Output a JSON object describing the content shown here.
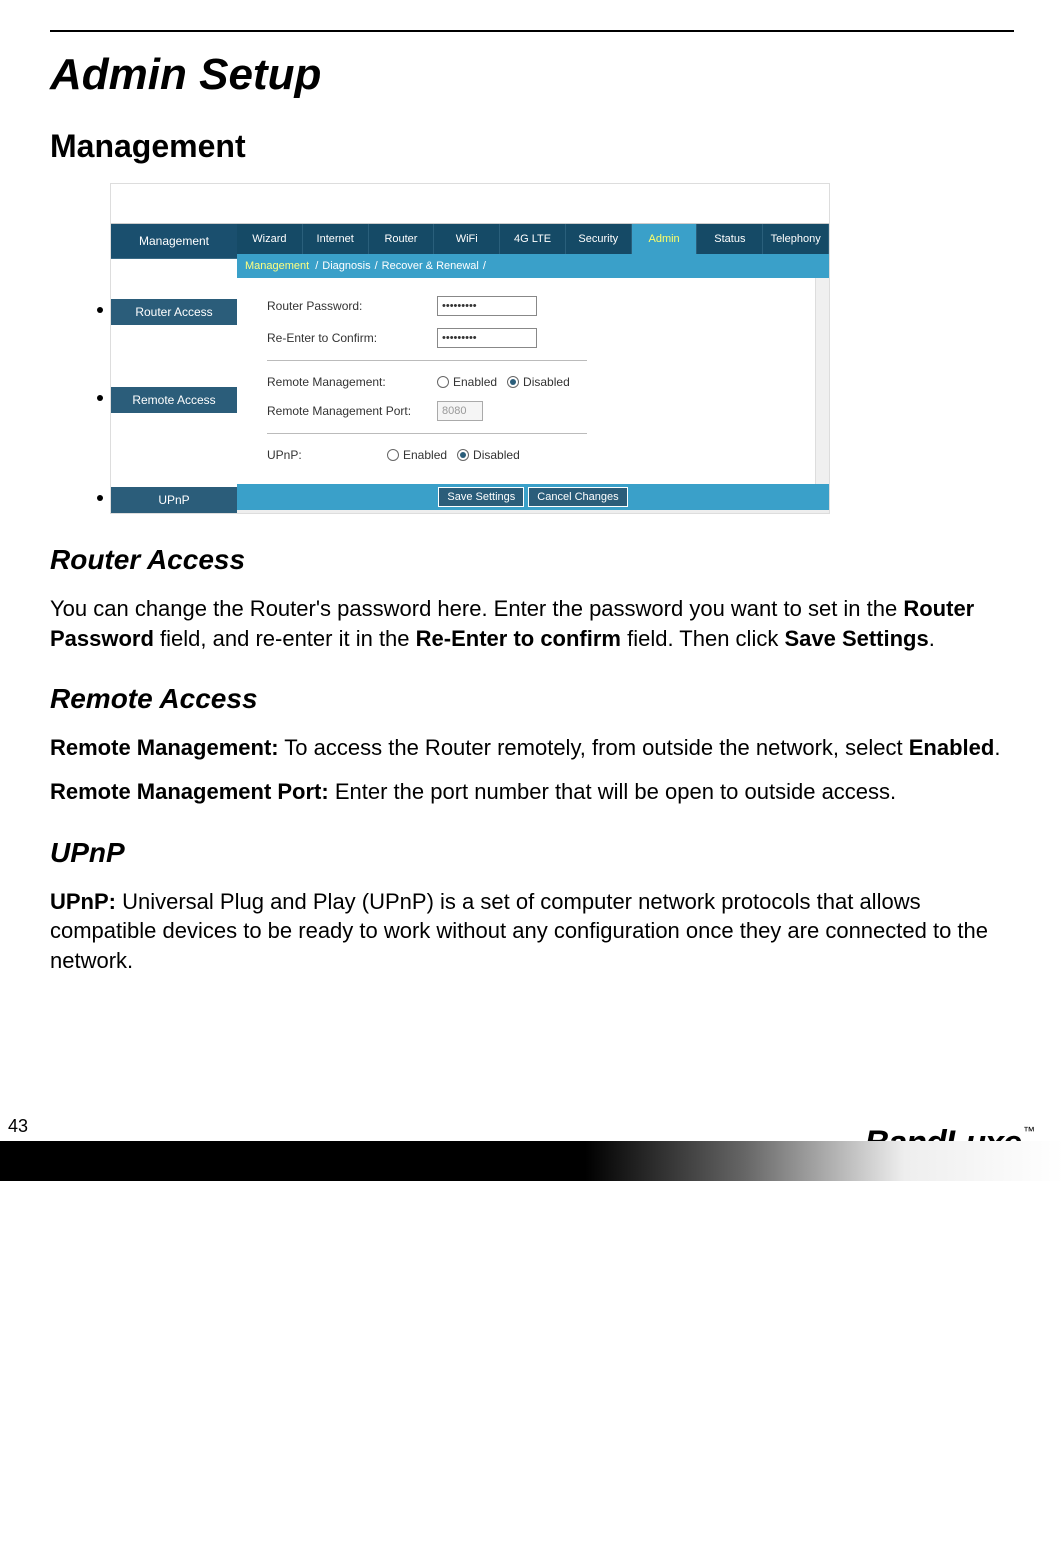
{
  "page_number": "43",
  "brand": "BandLuxe",
  "trademark": "™",
  "title": "Admin Setup",
  "sections": {
    "management": "Management",
    "router_access": "Router Access",
    "remote_access": "Remote Access",
    "upnp": "UPnP"
  },
  "body": {
    "router_access_1a": "You can change the Router's password here. Enter the password you want to set in the ",
    "router_access_1b": "Router Password",
    "router_access_1c": " field, and re-enter it in the ",
    "router_access_1d": "Re-Enter to confirm",
    "router_access_1e": " field. Then click ",
    "router_access_1f": "Save Settings",
    "router_access_1g": ".",
    "remote_mgmt_label": "Remote Management:",
    "remote_mgmt_text": " To access the Router remotely, from outside the network, select ",
    "remote_mgmt_bold": "Enabled",
    "remote_mgmt_end": ".",
    "remote_port_label": "Remote Management Port:",
    "remote_port_text": " Enter the port number that will be open to outside access.",
    "upnp_label": "UPnP:",
    "upnp_text": " Universal Plug and Play (UPnP) is a set of computer network protocols that allows compatible devices to be ready to work without any configuration once they are connected to the network."
  },
  "screenshot": {
    "sidebar": {
      "main": "Management",
      "items": [
        "Router Access",
        "Remote Access",
        "UPnP"
      ]
    },
    "tabs": [
      "Wizard",
      "Internet",
      "Router",
      "WiFi",
      "4G LTE",
      "Security",
      "Admin",
      "Status",
      "Telephony"
    ],
    "active_tab_index": 6,
    "subtabs": {
      "sel": "Management",
      "others": [
        "/",
        "Diagnosis",
        "/",
        "Recover & Renewal",
        "/"
      ]
    },
    "form": {
      "router_password_label": "Router Password:",
      "router_password_value": "•••••••••",
      "confirm_label": "Re-Enter to Confirm:",
      "confirm_value": "•••••••••",
      "remote_mgmt_label": "Remote Management:",
      "enabled": "Enabled",
      "disabled": "Disabled",
      "remote_port_label": "Remote Management Port:",
      "remote_port_value": "8080",
      "upnp_label": "UPnP:"
    },
    "buttons": {
      "save": "Save Settings",
      "cancel": "Cancel Changes"
    }
  }
}
